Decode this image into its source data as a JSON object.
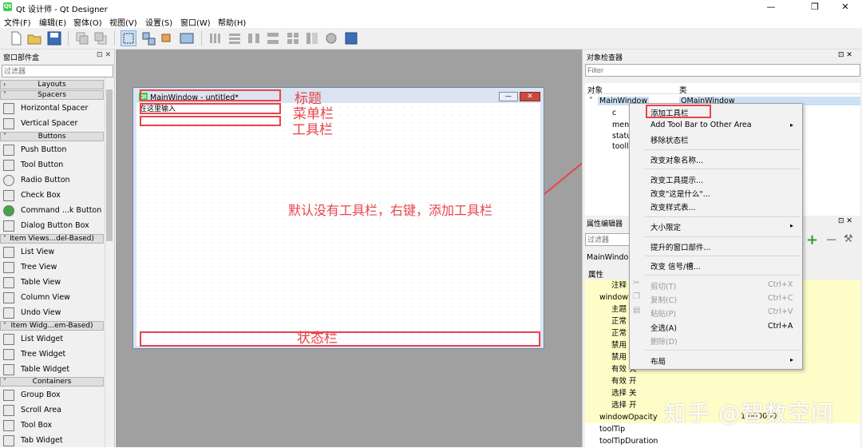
{
  "app": {
    "title": "Qt 设计师 - Qt Designer",
    "icon_text": "Qt"
  },
  "window_controls": {
    "minimize": "—",
    "maximize": "❐",
    "close": "✕"
  },
  "menubar": [
    "文件(F)",
    "编辑(E)",
    "窗体(O)",
    "视图(V)",
    "设置(S)",
    "窗口(W)",
    "帮助(H)"
  ],
  "left_dock": {
    "title": "窗口部件盒",
    "controls": "⊡ ✕",
    "filter_placeholder": "过滤器",
    "layouts": "Layouts",
    "spacers": "Spacers",
    "spacer_items": [
      "Horizontal Spacer",
      "Vertical Spacer"
    ],
    "buttons": "Buttons",
    "button_items": [
      "Push Button",
      "Tool Button",
      "Radio Button",
      "Check Box",
      "Command ...k Button",
      "Dialog Button Box"
    ],
    "item_views": "Item Views...del-Based)",
    "item_view_items": [
      "List View",
      "Tree View",
      "Table View",
      "Column View",
      "Undo View"
    ],
    "item_widgets": "Item Widg...em-Based)",
    "item_widget_items": [
      "List Widget",
      "Tree Widget",
      "Table Widget"
    ],
    "containers": "Containers",
    "container_items": [
      "Group Box",
      "Scroll Area",
      "Tool Box",
      "Tab Widget"
    ]
  },
  "form": {
    "title": "MainWindow - untitled*",
    "menu_placeholder": "在这里输入",
    "minimize": "—",
    "close": "✕"
  },
  "annotations": {
    "title": "标题",
    "menubar": "菜单栏",
    "toolbar": "工具栏",
    "statusbar": "状态栏",
    "hint": "默认没有工具栏，右键，添加工具栏"
  },
  "object_inspector": {
    "title": "对象检查器",
    "filter_placeholder": "Filter",
    "col_object": "对象",
    "col_class": "类",
    "root": "MainWindow",
    "root_class": "QMainWindow",
    "children": [
      "c",
      "men",
      "statu",
      "tooll"
    ]
  },
  "property_editor": {
    "title": "属性编辑器",
    "filter_placeholder": "过滤器",
    "object_name": "MainWindo",
    "col_property": "属性",
    "rows": [
      "注释",
      "windowI",
      "主题",
      "正常",
      "正常",
      "禁用",
      "禁用",
      "有效 关",
      "有效 开",
      "选择 关",
      "选择 开",
      "windowOpacity",
      "toolTip",
      "toolTipDuration"
    ],
    "opacity_value": "1.000000"
  },
  "context_menu": {
    "add_toolbar": "添加工具栏",
    "add_toolbar_other": "Add Tool Bar to Other Area",
    "remove_statusbar": "移除状态栏",
    "change_object_name": "改变对象名称...",
    "change_tooltip": "改变工具提示...",
    "change_whats_this": "改变\"这是什么\"...",
    "change_stylesheet": "改变样式表...",
    "size_constraints": "大小限定",
    "promoted_widgets": "提升的窗口部件...",
    "change_signals_slots": "改变 信号/槽...",
    "cut": "剪切(T)",
    "cut_shortcut": "Ctrl+X",
    "copy": "复制(C)",
    "copy_shortcut": "Ctrl+C",
    "paste": "粘贴(P)",
    "paste_shortcut": "Ctrl+V",
    "select_all": "全选(A)",
    "select_all_shortcut": "Ctrl+A",
    "delete": "删除(D)",
    "layout": "布局"
  },
  "watermark": "知乎 @智数空间",
  "colors": {
    "annotation_red": "#e8434a",
    "qt_green": "#41cd52",
    "property_yellow": "#fefdc7",
    "canvas_gray": "#a0a0a0"
  }
}
